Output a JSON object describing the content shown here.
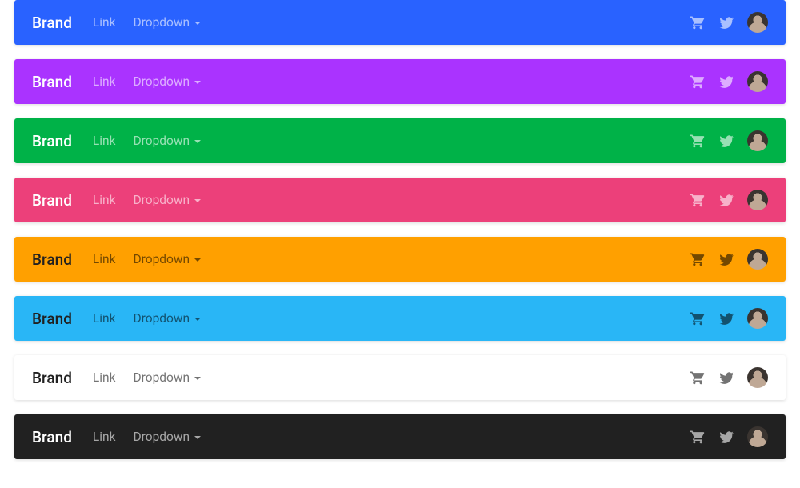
{
  "labels": {
    "brand": "Brand",
    "link": "Link",
    "dropdown": "Dropdown"
  },
  "navbars": [
    {
      "bg": "#2962ff",
      "scheme": "light"
    },
    {
      "bg": "#aa33ff",
      "scheme": "light"
    },
    {
      "bg": "#00b248",
      "scheme": "light"
    },
    {
      "bg": "#ec407a",
      "scheme": "light"
    },
    {
      "bg": "#ffa000",
      "scheme": "dark"
    },
    {
      "bg": "#29b6f6",
      "scheme": "dark"
    },
    {
      "bg": "#ffffff",
      "scheme": "dark"
    },
    {
      "bg": "#212121",
      "scheme": "light"
    }
  ]
}
